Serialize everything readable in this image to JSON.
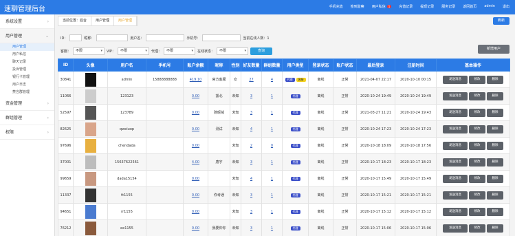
{
  "app_title": "速聊管理后台",
  "top_nav": [
    {
      "label": "手机充值"
    },
    {
      "label": "签到监察"
    },
    {
      "label": "用户私信",
      "badge": "1"
    },
    {
      "label": "充值记录"
    },
    {
      "label": "提现记录"
    },
    {
      "label": "服务记录"
    },
    {
      "label": "返回首页"
    },
    {
      "label": "admin"
    },
    {
      "label": "退出"
    }
  ],
  "sidebar": {
    "groups": [
      {
        "label": "系统设置",
        "open": false
      },
      {
        "label": "用户管理",
        "open": true,
        "items": [
          {
            "label": "用户管理",
            "active": true
          },
          {
            "label": "用户私信"
          },
          {
            "label": "聊天记录"
          },
          {
            "label": "投诉管理"
          },
          {
            "label": "银行卡管理"
          },
          {
            "label": "用户日志"
          },
          {
            "label": "禁言群管理"
          }
        ]
      },
      {
        "label": "资金管理",
        "open": false
      },
      {
        "label": "群组管理",
        "open": false
      },
      {
        "label": "权限",
        "open": false
      }
    ]
  },
  "tabs": [
    {
      "label": "当前位置：后台"
    },
    {
      "label": "用户管理"
    },
    {
      "label": "用户管理",
      "active": true
    }
  ],
  "refresh_label": "刷新",
  "filters": {
    "id_label": "ID：",
    "nickname_label": "昵称：",
    "username_label": "用户名：",
    "phone_label": "手机号：",
    "online_count_label": "当前在线人数：1",
    "gender_label": "客服：",
    "gender_value": "不限",
    "vip_label": "VIP：",
    "vip_value": "不限",
    "agent_label": "代理：",
    "agent_value": "不限",
    "online_status_label": "在线状态：",
    "online_status_value": "不限",
    "query_label": "查询",
    "add_user_label": "新增用户"
  },
  "table": {
    "headers": [
      "ID",
      "头像",
      "用户名",
      "手机号",
      "账户余额",
      "昵称",
      "性别",
      "好友数量",
      "群组数量",
      "用户类型",
      "登录状态",
      "账户状态",
      "最后登录",
      "注册时间",
      "基本操作"
    ],
    "actions": {
      "message": "发送消息",
      "edit": "修改",
      "delete": "删除"
    },
    "rows": [
      {
        "id": "30841",
        "username": "admin",
        "phone": "15888888888",
        "balance": "419.10",
        "nickname": "官方客服",
        "gender": "女",
        "friends": "27",
        "groups": "4",
        "type": "代理",
        "vip": "客服",
        "login": "离线",
        "status": "正常",
        "last_login": "2021-04-07 22:17",
        "register": "2020-10-10 00:15",
        "avatar_color": "#111"
      },
      {
        "id": "11066",
        "username": "123123",
        "phone": "",
        "balance": "0.00",
        "nickname": "拔北",
        "gender": "未知",
        "friends": "3",
        "groups": "1",
        "type": "代理",
        "vip": "",
        "login": "离线",
        "status": "正常",
        "last_login": "2020-10-24 19:49",
        "register": "2020-10-24 19:49",
        "avatar_color": "#ccc"
      },
      {
        "id": "52597",
        "username": "123789",
        "phone": "",
        "balance": "0.00",
        "nickname": "驰昵绒",
        "gender": "未知",
        "friends": "3",
        "groups": "1",
        "type": "代理",
        "vip": "",
        "login": "离线",
        "status": "正常",
        "last_login": "2021-03-27 11:21",
        "register": "2020-10-24 19:43",
        "avatar_color": "#555"
      },
      {
        "id": "82625",
        "username": "qweiuop",
        "phone": "",
        "balance": "0.00",
        "nickname": "测试",
        "gender": "未知",
        "friends": "4",
        "groups": "1",
        "type": "代理",
        "vip": "",
        "login": "离线",
        "status": "正常",
        "last_login": "2020-10-24 17:23",
        "register": "2020-10-24 17:23",
        "avatar_color": "#d9a58a"
      },
      {
        "id": "97696",
        "username": "chendada",
        "phone": "",
        "balance": "0.00",
        "nickname": "",
        "gender": "未知",
        "friends": "2",
        "groups": "0",
        "type": "代理",
        "vip": "",
        "login": "离线",
        "status": "正常",
        "last_login": "2020-10-18 18:09",
        "register": "2020-10-18 17:56",
        "avatar_color": "#e8b040"
      },
      {
        "id": "37001",
        "username": "15637622561",
        "phone": "",
        "balance": "4.00",
        "nickname": "唐宇",
        "gender": "未知",
        "friends": "3",
        "groups": "1",
        "type": "代理",
        "vip": "",
        "login": "离线",
        "status": "正常",
        "last_login": "2020-10-17 18:23",
        "register": "2020-10-17 18:23",
        "avatar_color": "#bdbdbd"
      },
      {
        "id": "99659",
        "username": "dada15154",
        "phone": "",
        "balance": "0.00",
        "nickname": "",
        "gender": "未知",
        "friends": "4",
        "groups": "1",
        "type": "代理",
        "vip": "",
        "login": "离线",
        "status": "正常",
        "last_login": "2020-10-17 15:49",
        "register": "2020-10-17 15:49",
        "avatar_color": "#c89880"
      },
      {
        "id": "11337",
        "username": "tt1155",
        "phone": "",
        "balance": "0.00",
        "nickname": "你考通",
        "gender": "未知",
        "friends": "3",
        "groups": "1",
        "type": "代理",
        "vip": "",
        "login": "离线",
        "status": "正常",
        "last_login": "2020-10-17 15:21",
        "register": "2020-10-17 15:21",
        "avatar_color": "#333"
      },
      {
        "id": "94651",
        "username": "rr1155",
        "phone": "",
        "balance": "0.00",
        "nickname": "",
        "gender": "未知",
        "friends": "3",
        "groups": "1",
        "type": "代理",
        "vip": "",
        "login": "离线",
        "status": "正常",
        "last_login": "2020-10-17 15:12",
        "register": "2020-10-17 15:12",
        "avatar_color": "#4a7bd0"
      },
      {
        "id": "76212",
        "username": "ee1155",
        "phone": "",
        "balance": "0.00",
        "nickname": "我要你你",
        "gender": "未知",
        "friends": "3",
        "groups": "1",
        "type": "代理",
        "vip": "",
        "login": "离线",
        "status": "正常",
        "last_login": "2020-10-17 15:06",
        "register": "2020-10-17 15:06",
        "avatar_color": "#8a5a3c"
      }
    ]
  }
}
